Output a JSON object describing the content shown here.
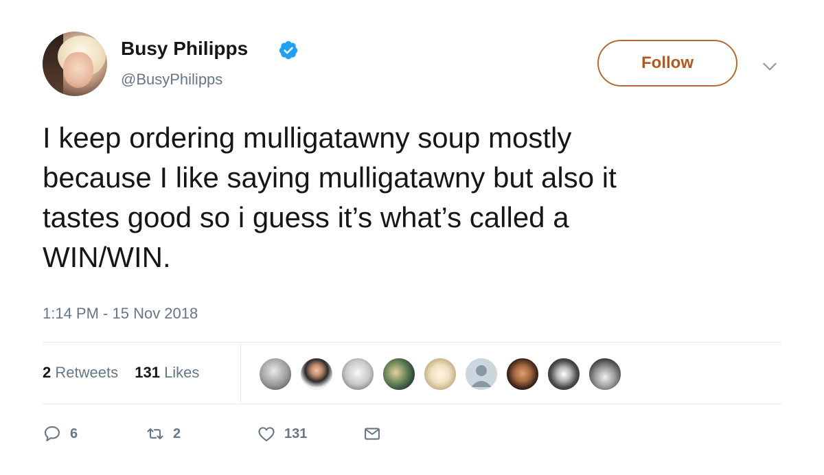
{
  "tweet": {
    "author": {
      "name": "Busy Philipps",
      "handle": "@BusyPhilipps",
      "verified": true
    },
    "follow_label": "Follow",
    "text": "I keep ordering mulligatawny soup mostly\nbecause I like saying mulligatawny but also it\ntastes good so i guess it’s what’s called a\nWIN/WIN.",
    "timestamp": "1:14 PM - 15 Nov 2018",
    "stats": {
      "retweets_count": "2",
      "retweets_label": "Retweets",
      "likes_count": "131",
      "likes_label": "Likes"
    },
    "liker_avatar_count": 9,
    "actions": {
      "reply_count": "6",
      "retweet_count": "2",
      "like_count": "131"
    }
  },
  "icons": {
    "verified": "verified-badge-icon",
    "more": "chevron-down-icon",
    "reply": "reply-icon",
    "retweet": "retweet-icon",
    "like": "heart-icon",
    "dm": "envelope-icon"
  },
  "colors": {
    "text": "#14171a",
    "secondary": "#657786",
    "follow_accent": "#b4571c",
    "verified_blue": "#1da1f2",
    "divider": "#e6ecf0"
  }
}
